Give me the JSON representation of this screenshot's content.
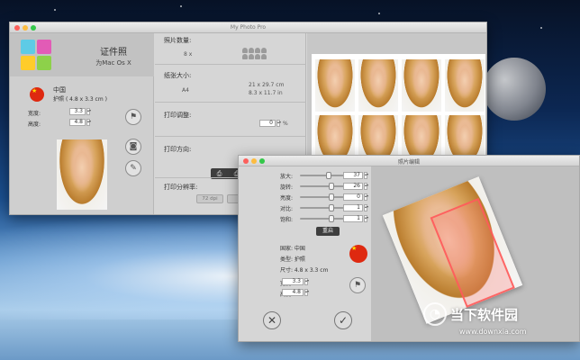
{
  "main_window": {
    "title": "My Photo Pro",
    "app_title": "证件照",
    "app_subtitle": "为Mac Os X",
    "country": "中国",
    "doc_type_label": "护照",
    "doc_size": "( 4.8 x 3.3 cm )",
    "width_label": "宽度:",
    "width_value": "3.3",
    "height_label": "高度:",
    "height_value": "4.8",
    "photo_count_label": "照片数量:",
    "photo_count_value": "8 x",
    "paper_size_label": "纸张大小:",
    "paper_size_name": "A4",
    "paper_size_cm": "21 x 29.7 cm",
    "paper_size_in": "8.3 x 11.7 in",
    "print_adjust_label": "打印调整:",
    "print_adjust_value": "0",
    "print_adjust_unit": "%",
    "print_direction_label": "打印方向:",
    "print_resolution_label": "打印分辨率:",
    "resolution_option": "72 dpi"
  },
  "editor_window": {
    "title": "照片编辑",
    "controls": [
      {
        "label": "放大:",
        "value": "37",
        "level": 0.45
      },
      {
        "label": "旋转:",
        "value": "26",
        "level": 0.5
      },
      {
        "label": "亮度:",
        "value": "0",
        "level": 0.5
      },
      {
        "label": "对比:",
        "value": "1",
        "level": 0.5
      },
      {
        "label": "饱和:",
        "value": "1",
        "level": 0.5
      }
    ],
    "reset_label": "重启",
    "country_line": "国家: 中国",
    "type_line": "类型: 护照",
    "size_line": "尺寸: 4.8 x 3.3 cm",
    "width_label": "宽度:",
    "width_value": "3.3",
    "height_label": "高度:",
    "height_value": "4.8"
  },
  "watermark": {
    "brand": "当下软件园",
    "url": "www.downxia.com"
  },
  "colors": {
    "flag_red": "#de2910",
    "flag_star": "#ffde00",
    "dark_button": "#3e3e3e"
  },
  "icons": [
    "flag-icon",
    "camera-icon",
    "dropper-icon",
    "printer-icon",
    "close-icon",
    "check-icon"
  ]
}
